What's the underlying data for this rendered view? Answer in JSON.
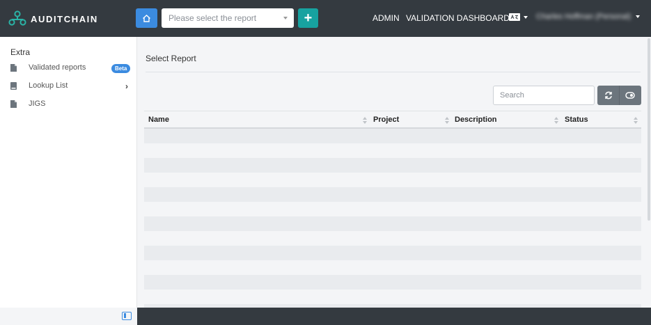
{
  "brand": {
    "name": "AUDITCHAIN"
  },
  "header": {
    "report_placeholder": "Please select the report",
    "add_label": "+",
    "admin_label": "ADMIN",
    "validation_label": "VALIDATION DASHBOARD",
    "language_icon": "language-icon",
    "user_name": "Charles Hoffman (Personal)"
  },
  "sidebar": {
    "heading": "Extra",
    "items": [
      {
        "label": "Validated reports",
        "icon": "document-icon",
        "badge": "Beta"
      },
      {
        "label": "Lookup List",
        "icon": "book-icon",
        "has_submenu": true
      },
      {
        "label": "JIGS",
        "icon": "document-icon"
      }
    ]
  },
  "main": {
    "title": "Select Report",
    "search_placeholder": "Search",
    "table": {
      "columns": [
        "Name",
        "Project",
        "Description",
        "Status"
      ],
      "rows": []
    }
  },
  "colors": {
    "header_bg": "#343a40",
    "accent_blue": "#3b8be0",
    "accent_teal": "#17a2a0",
    "tool_gray": "#6c757d"
  }
}
